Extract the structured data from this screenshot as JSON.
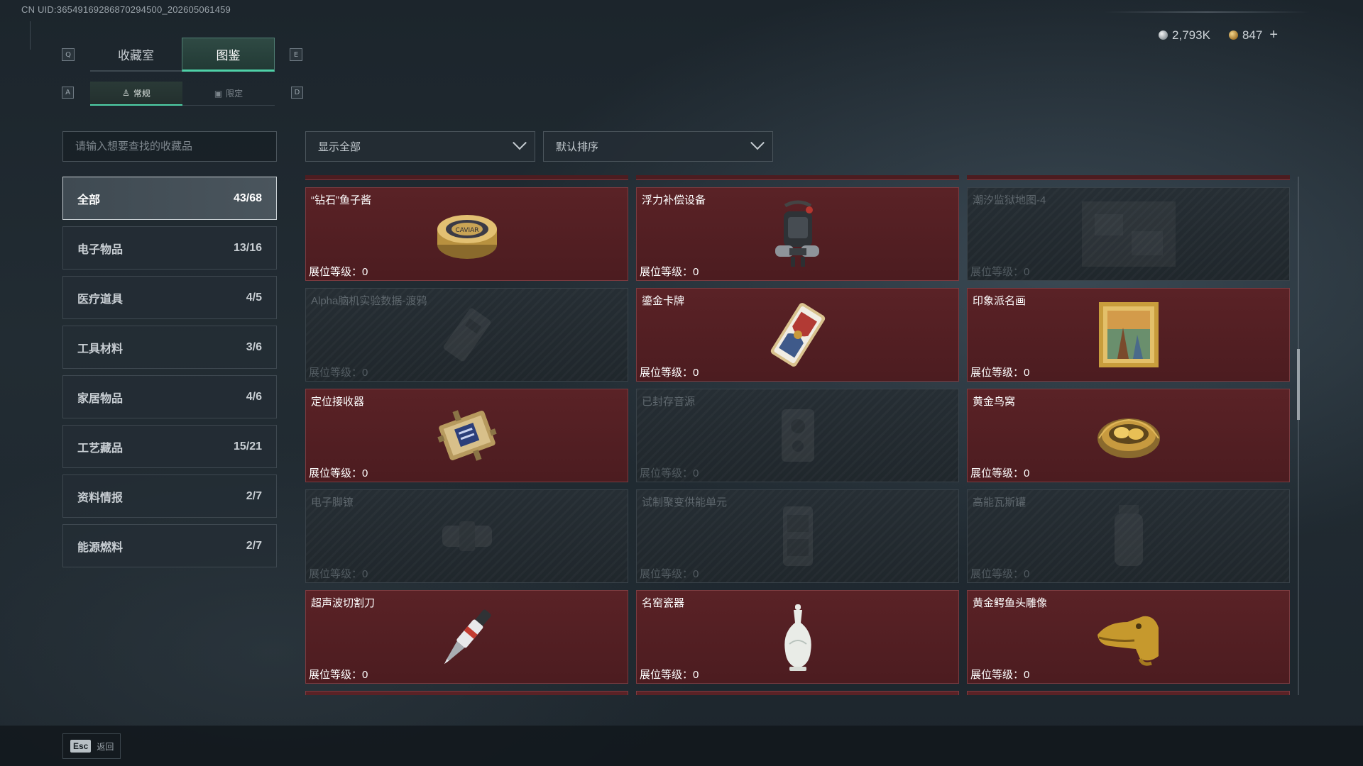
{
  "uid_text": "CN UID:36549169286870294500_202605061459",
  "currency": {
    "silver_amount": "2,793K",
    "gold_amount": "847",
    "plus_label": "+"
  },
  "tabs": {
    "left_key": "Q",
    "right_key": "E",
    "items": [
      {
        "label": "收藏室",
        "active": false
      },
      {
        "label": "图鉴",
        "active": true
      }
    ]
  },
  "subtabs": {
    "left_key": "A",
    "right_key": "D",
    "items": [
      {
        "label": "常规",
        "icon": "figure-icon",
        "active": true
      },
      {
        "label": "限定",
        "icon": "card-icon",
        "active": false
      }
    ]
  },
  "search": {
    "placeholder": "请输入想要查找的收藏品"
  },
  "categories": [
    {
      "label": "全部",
      "count": "43/68",
      "active": true
    },
    {
      "label": "电子物品",
      "count": "13/16",
      "active": false
    },
    {
      "label": "医疗道具",
      "count": "4/5",
      "active": false
    },
    {
      "label": "工具材料",
      "count": "3/6",
      "active": false
    },
    {
      "label": "家居物品",
      "count": "4/6",
      "active": false
    },
    {
      "label": "工艺藏品",
      "count": "15/21",
      "active": false
    },
    {
      "label": "资料情报",
      "count": "2/7",
      "active": false
    },
    {
      "label": "能源燃料",
      "count": "2/7",
      "active": false
    }
  ],
  "filters": {
    "show_label": "显示全部",
    "sort_label": "默认排序"
  },
  "level_label": "展位等级：",
  "items": [
    {
      "name": "“钻石”鱼子酱",
      "level": "0",
      "owned": true,
      "icon": "caviar-tin-icon"
    },
    {
      "name": "浮力补偿设备",
      "level": "0",
      "owned": true,
      "icon": "buoyancy-device-icon"
    },
    {
      "name": "潮汐监狱地图-4",
      "level": "0",
      "owned": false,
      "icon": "map-icon"
    },
    {
      "name": "Alpha脑机实验数据-渡鸦",
      "level": "0",
      "owned": false,
      "icon": "data-drive-icon"
    },
    {
      "name": "鎏金卡牌",
      "level": "0",
      "owned": true,
      "icon": "gilded-card-icon"
    },
    {
      "name": "印象派名画",
      "level": "0",
      "owned": true,
      "icon": "painting-icon"
    },
    {
      "name": "定位接收器",
      "level": "0",
      "owned": true,
      "icon": "receiver-icon"
    },
    {
      "name": "已封存音源",
      "level": "0",
      "owned": false,
      "icon": "audio-device-icon"
    },
    {
      "name": "黄金鸟窝",
      "level": "0",
      "owned": true,
      "icon": "golden-nest-icon"
    },
    {
      "name": "电子脚镣",
      "level": "0",
      "owned": false,
      "icon": "ankle-monitor-icon"
    },
    {
      "name": "试制聚变供能单元",
      "level": "0",
      "owned": false,
      "icon": "fusion-unit-icon"
    },
    {
      "name": "高能瓦斯罐",
      "level": "0",
      "owned": false,
      "icon": "gas-canister-icon"
    },
    {
      "name": "超声波切割刀",
      "level": "0",
      "owned": true,
      "icon": "ultrasonic-cutter-icon"
    },
    {
      "name": "名窑瓷器",
      "level": "0",
      "owned": true,
      "icon": "porcelain-vase-icon"
    },
    {
      "name": "黄金鳄鱼头雕像",
      "level": "0",
      "owned": true,
      "icon": "golden-crocodile-icon"
    }
  ],
  "bottom": {
    "esc_key": "Esc",
    "esc_label": "返回"
  },
  "colors": {
    "accent": "#4fd1a8",
    "owned_card": "#5a2226",
    "locked_card": "#262e34",
    "background": "#1f2930"
  }
}
